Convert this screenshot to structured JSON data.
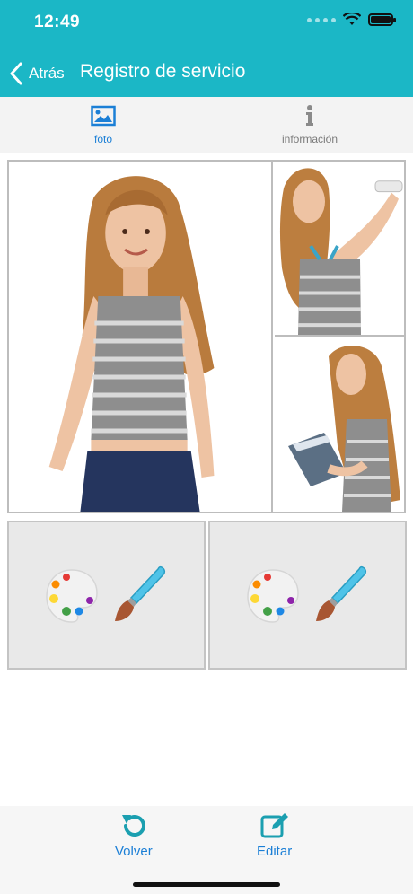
{
  "status_bar": {
    "time": "12:49"
  },
  "nav": {
    "back_label": "Atrás",
    "title": "Registro de servicio"
  },
  "tabs": [
    {
      "label": "foto",
      "icon": "image-icon",
      "active": true
    },
    {
      "label": "información",
      "icon": "info-icon",
      "active": false
    }
  ],
  "photos": [
    {
      "icon": "photo-girl-smiling"
    },
    {
      "icon": "photo-girl-painting-wall"
    },
    {
      "icon": "photo-girl-with-folder"
    }
  ],
  "paint_tiles": [
    {
      "icon": "palette-brush-icon"
    },
    {
      "icon": "palette-brush-icon"
    }
  ],
  "bottom_bar": {
    "volver_label": "Volver",
    "editar_label": "Editar"
  },
  "colors": {
    "header": "#1bb7c6",
    "accent": "#1b7fd6",
    "tile_bg": "#e9e9e9"
  }
}
